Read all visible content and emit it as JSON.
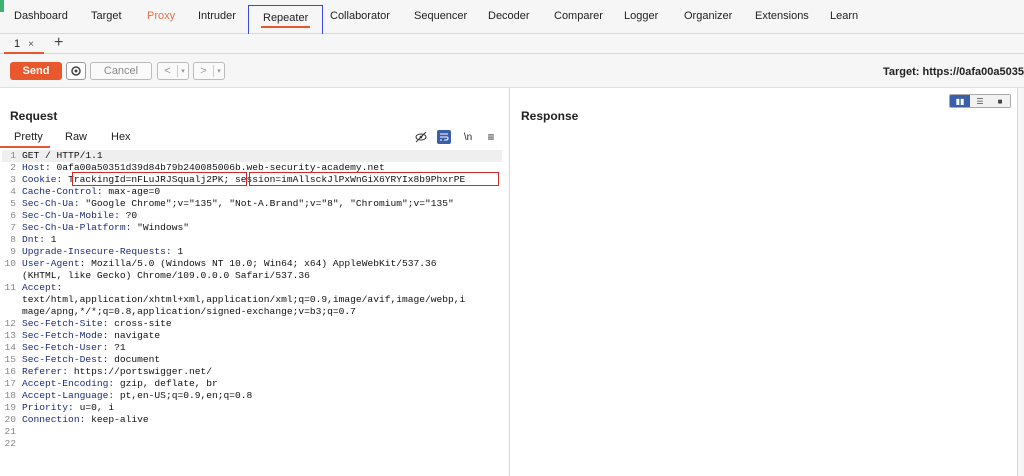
{
  "nav": {
    "items": [
      "Dashboard",
      "Target",
      "Proxy",
      "Intruder",
      "Repeater",
      "Collaborator",
      "Sequencer",
      "Decoder",
      "Comparer",
      "Logger",
      "Organizer",
      "Extensions",
      "Learn"
    ],
    "active": "Repeater"
  },
  "tabs": {
    "label": "1",
    "close": "×",
    "add": "+"
  },
  "toolbar": {
    "send": "Send",
    "cancel": "Cancel",
    "back": "<",
    "forward": ">",
    "dropdown": "▾",
    "target": "Target: https://0afa00a5035"
  },
  "request": {
    "title": "Request",
    "tabs": [
      "Pretty",
      "Raw",
      "Hex"
    ],
    "active_tab": "Pretty",
    "tools": {
      "hide": "hide-icon",
      "wrap": "wrap-icon",
      "newline": "\\n",
      "menu": "≡"
    },
    "lines": [
      {
        "n": "1",
        "name": "",
        "value": "GET / HTTP/1.1"
      },
      {
        "n": "2",
        "name": "Host:",
        "value": " 0afa00a50351d39d84b79b240085006b.web-security-academy.net"
      },
      {
        "n": "3",
        "name": "Cookie:",
        "value": " TrackingId=nFLuJRJSqualj2PK; session=imAllsckJlPxWnGiX6YRYIx8b9PhxrPE"
      },
      {
        "n": "4",
        "name": "Cache-Control:",
        "value": " max-age=0"
      },
      {
        "n": "5",
        "name": "Sec-Ch-Ua:",
        "value": " \"Google Chrome\";v=\"135\", \"Not-A.Brand\";v=\"8\", \"Chromium\";v=\"135\""
      },
      {
        "n": "6",
        "name": "Sec-Ch-Ua-Mobile:",
        "value": " ?0"
      },
      {
        "n": "7",
        "name": "Sec-Ch-Ua-Platform:",
        "value": " \"Windows\""
      },
      {
        "n": "8",
        "name": "Dnt:",
        "value": " 1"
      },
      {
        "n": "9",
        "name": "Upgrade-Insecure-Requests:",
        "value": " 1"
      },
      {
        "n": "10",
        "name": "User-Agent:",
        "value": " Mozilla/5.0 (Windows NT 10.0; Win64; x64) AppleWebKit/537.36"
      },
      {
        "n": "",
        "name": "",
        "value": "(KHTML, like Gecko) Chrome/109.0.0.0 Safari/537.36"
      },
      {
        "n": "11",
        "name": "Accept:",
        "value": ""
      },
      {
        "n": "",
        "name": "",
        "value": "text/html,application/xhtml+xml,application/xml;q=0.9,image/avif,image/webp,i"
      },
      {
        "n": "",
        "name": "",
        "value": "mage/apng,*/*;q=0.8,application/signed-exchange;v=b3;q=0.7"
      },
      {
        "n": "12",
        "name": "Sec-Fetch-Site:",
        "value": " cross-site"
      },
      {
        "n": "13",
        "name": "Sec-Fetch-Mode:",
        "value": " navigate"
      },
      {
        "n": "14",
        "name": "Sec-Fetch-User:",
        "value": " ?1"
      },
      {
        "n": "15",
        "name": "Sec-Fetch-Dest:",
        "value": " document"
      },
      {
        "n": "16",
        "name": "Referer:",
        "value": " https://portswigger.net/"
      },
      {
        "n": "17",
        "name": "Accept-Encoding:",
        "value": " gzip, deflate, br"
      },
      {
        "n": "18",
        "name": "Accept-Language:",
        "value": " pt,en-US;q=0.9,en;q=0.8"
      },
      {
        "n": "19",
        "name": "Priority:",
        "value": " u=0, i"
      },
      {
        "n": "20",
        "name": "Connection:",
        "value": " keep-alive"
      },
      {
        "n": "21",
        "name": "",
        "value": ""
      },
      {
        "n": "22",
        "name": "",
        "value": ""
      }
    ]
  },
  "response": {
    "title": "Response"
  },
  "colors": {
    "accent": "#e8582c",
    "highlight_box": "#d62828",
    "active_nav_box": "#3a4bd4",
    "header_name": "#1f2d7a"
  }
}
